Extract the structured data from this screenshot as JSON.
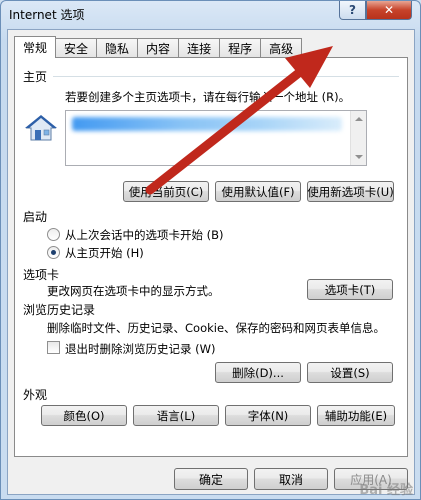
{
  "window": {
    "title": "Internet 选项",
    "help_label": "?",
    "close_label": "✕"
  },
  "tabs": [
    {
      "label": "常规",
      "active": true
    },
    {
      "label": "安全"
    },
    {
      "label": "隐私"
    },
    {
      "label": "内容"
    },
    {
      "label": "连接"
    },
    {
      "label": "程序"
    },
    {
      "label": "高级"
    }
  ],
  "home": {
    "section_title": "主页",
    "description": "若要创建多个主页选项卡，请在每行输入一个地址 (R)。",
    "url_value": "",
    "buttons": {
      "use_current": "使用当前页(C)",
      "use_default": "使用默认值(F)",
      "use_new_tab": "使用新选项卡(U)"
    }
  },
  "startup": {
    "section_title": "启动",
    "option_last_session": "从上次会话中的选项卡开始 (B)",
    "option_home": "从主页开始 (H)",
    "selected": "home"
  },
  "tabs_section": {
    "section_title": "选项卡",
    "description": "更改网页在选项卡中的显示方式。",
    "button": "选项卡(T)"
  },
  "history": {
    "section_title": "浏览历史记录",
    "description": "删除临时文件、历史记录、Cookie、保存的密码和网页表单信息。",
    "checkbox_label": "退出时删除浏览历史记录 (W)",
    "checkbox_checked": false,
    "delete_button": "删除(D)...",
    "settings_button": "设置(S)"
  },
  "appearance": {
    "section_title": "外观",
    "buttons": [
      "颜色(O)",
      "语言(L)",
      "字体(N)",
      "辅助功能(E)"
    ]
  },
  "footer": {
    "ok": "确定",
    "cancel": "取消",
    "apply": "应用(A)"
  },
  "watermark": "Bai 经验",
  "colors": {
    "arrow": "#c0281c",
    "title_bg": "#c9dcf0",
    "close": "#c7432a"
  }
}
